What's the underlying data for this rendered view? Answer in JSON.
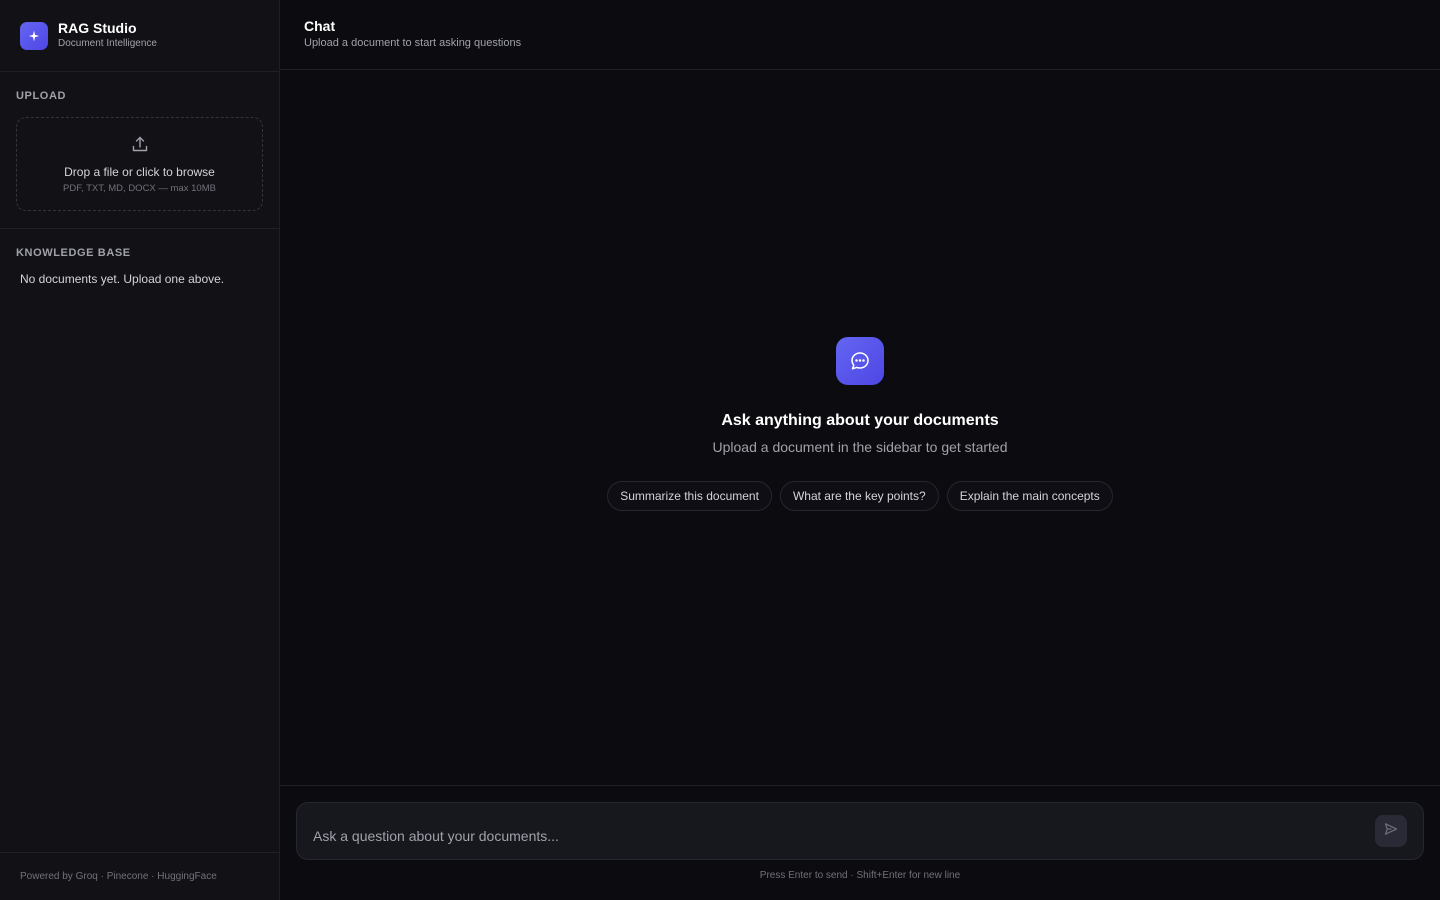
{
  "brand": {
    "title": "RAG Studio",
    "subtitle": "Document Intelligence",
    "logo_icon": "sparkle-icon",
    "accent": "#6366f1"
  },
  "sidebar": {
    "upload": {
      "section_title": "UPLOAD",
      "drop_text": "Drop a file or click to browse",
      "formats_text": "PDF, TXT, MD, DOCX — max 10MB",
      "icon": "upload-icon"
    },
    "knowledge_base": {
      "section_title": "KNOWLEDGE BASE",
      "empty_text": "No documents yet. Upload one above."
    },
    "footer": "Powered by Groq · Pinecone · HuggingFace"
  },
  "header": {
    "title": "Chat",
    "subtitle": "Upload a document to start asking questions"
  },
  "empty_state": {
    "icon": "chat-bubble-icon",
    "title": "Ask anything about your documents",
    "subtitle": "Upload a document in the sidebar to get started",
    "suggestions": [
      "Summarize this document",
      "What are the key points?",
      "Explain the main concepts"
    ]
  },
  "composer": {
    "placeholder": "Ask a question about your documents...",
    "value": "",
    "send_icon": "send-icon",
    "hint": "Press Enter to send · Shift+Enter for new line"
  }
}
